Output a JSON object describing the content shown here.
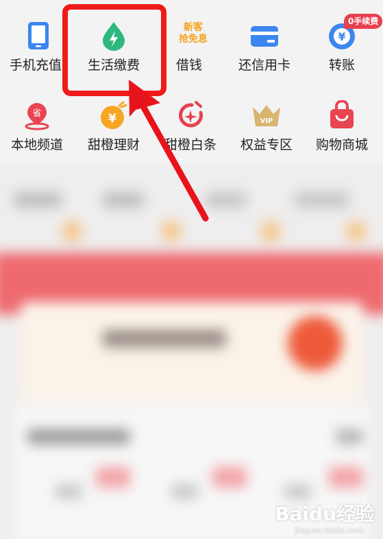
{
  "grid_row1": [
    {
      "label": "手机充值",
      "icon": "phone-icon"
    },
    {
      "label": "生活缴费",
      "icon": "water-drop-bolt-icon"
    },
    {
      "label": "借钱",
      "icon": "new-customer-badge-icon"
    },
    {
      "label": "还信用卡",
      "icon": "credit-card-icon"
    },
    {
      "label": "转账",
      "icon": "yuan-transfer-icon"
    }
  ],
  "grid_row2": [
    {
      "label": "本地频道",
      "icon": "province-location-icon"
    },
    {
      "label": "甜橙理财",
      "icon": "orange-yuan-icon"
    },
    {
      "label": "甜橙白条",
      "icon": "circle-clock-icon"
    },
    {
      "label": "权益专区",
      "icon": "vip-crown-icon"
    },
    {
      "label": "购物商城",
      "icon": "shopping-bag-icon"
    }
  ],
  "jiequan_badge": {
    "line1": "新客",
    "line2": "抢免息"
  },
  "transfer_badge": "0手续费",
  "province_icon_text": "省",
  "yuan_symbol": "¥",
  "vip_text": "VIP",
  "watermark": {
    "brand": "Baidu经验",
    "url": "jingyan.baidu.com"
  },
  "colors": {
    "highlight": "#ef1a1a",
    "arrow": "#e8141c",
    "accent_orange": "#f4a21c",
    "badge_red": "#e8404e"
  }
}
